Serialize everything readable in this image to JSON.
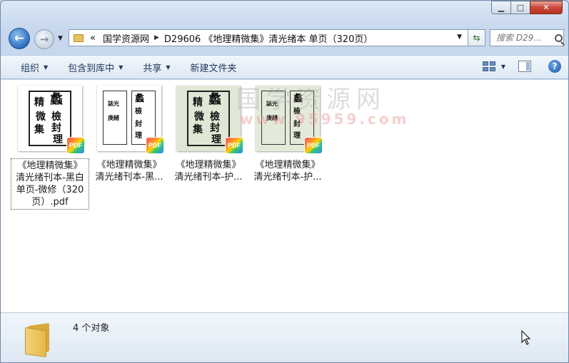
{
  "window": {
    "caption_minimize": "▁",
    "caption_maximize": "□",
    "caption_close": "✕"
  },
  "navigation": {
    "back_glyph": "←",
    "forward_glyph": "→",
    "breadcrumb_overflow": "«",
    "breadcrumbs": [
      "国学资源网",
      "D29606 《地理精微集》清光绪本 单页（320页）"
    ],
    "search_placeholder": "搜索 D29..."
  },
  "toolbar": {
    "organize": "组织",
    "include_in_library": "包含到库中",
    "share": "共享",
    "new_folder": "新建文件夹"
  },
  "files": [
    {
      "lines": [
        "《地理精微集》",
        "清光绪刊本-黑白",
        "单页-微修（320",
        "页）.pdf"
      ],
      "selected": true,
      "thumb_bg": "#ffffff",
      "badge": "PDF"
    },
    {
      "lines": [
        "《地理精微集》",
        "清光绪刊本-黑..."
      ],
      "selected": false,
      "thumb_bg": "#ffffff",
      "badge": "PDF"
    },
    {
      "lines": [
        "《地理精微集》",
        "清光绪刊本-护..."
      ],
      "selected": false,
      "thumb_bg": "#dfe8d4",
      "badge": "PDF"
    },
    {
      "lines": [
        "《地理精微集》",
        "清光绪刊本-护..."
      ],
      "selected": false,
      "thumb_bg": "#e4ead9",
      "badge": "PDF"
    }
  ],
  "watermark": {
    "text": "国学资源网",
    "url": "www.95959.com"
  },
  "details": {
    "count": "4 个对象"
  },
  "colors": {
    "accent": "#1e395b",
    "selection_border": "#555555"
  }
}
